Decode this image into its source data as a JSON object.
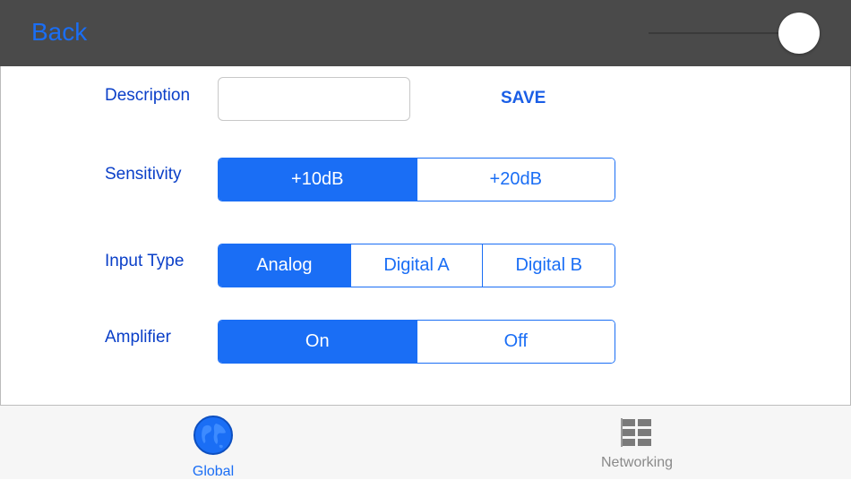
{
  "header": {
    "back_label": "Back"
  },
  "form": {
    "description": {
      "label": "Description",
      "value": "",
      "placeholder": ""
    },
    "save_label": "SAVE",
    "sensitivity": {
      "label": "Sensitivity",
      "options": [
        "+10dB",
        "+20dB"
      ],
      "selected": "+10dB"
    },
    "input_type": {
      "label": "Input Type",
      "options": [
        "Analog",
        "Digital A",
        "Digital B"
      ],
      "selected": "Analog"
    },
    "amplifier": {
      "label": "Amplifier",
      "options": [
        "On",
        "Off"
      ],
      "selected": "On"
    }
  },
  "tabs": [
    {
      "label": "Global",
      "icon": "globe-icon",
      "active": true
    },
    {
      "label": "Networking",
      "icon": "grid-icon",
      "active": false
    }
  ],
  "colors": {
    "accent": "#1a6ef5",
    "header_bg": "#4a4a4a",
    "label": "#0a3fc8"
  }
}
